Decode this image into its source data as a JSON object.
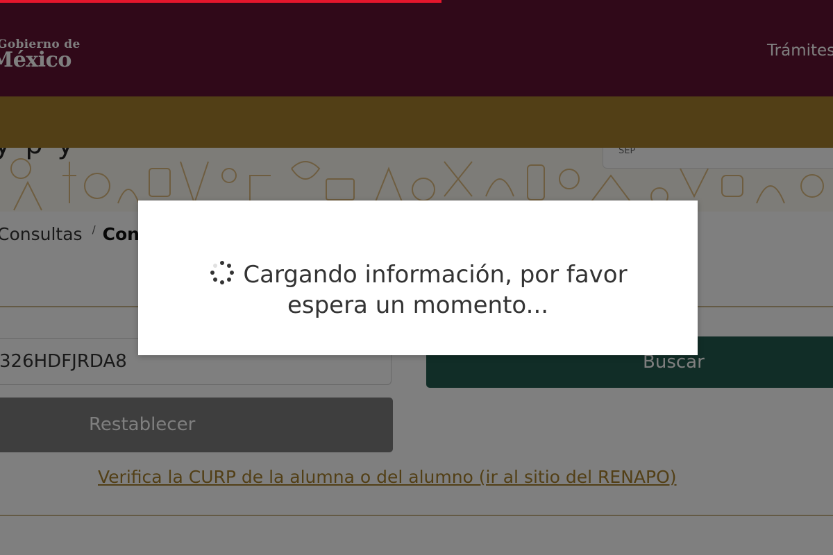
{
  "progress": {
    "fraction": 0.53,
    "color": "#e4162c"
  },
  "header": {
    "logo_line1": "Gobierno de",
    "logo_line2": "México",
    "nav_link": "Trámites",
    "color": "#611232"
  },
  "gold_bar": {
    "color": "#a57f2c"
  },
  "hero": {
    "title_partial": "y p     y",
    "card_text": "SEP"
  },
  "breadcrumb": {
    "parent": "Consultas",
    "current": "Consulta"
  },
  "form": {
    "curp_value": "326HDFJRDA8",
    "search_label": "Buscar",
    "reset_label": "Restablecer",
    "renapo_link": "Verifica la CURP de la alumna o del alumno (ir al sitio del RENAPO)"
  },
  "modal": {
    "line1": "Cargando información, por favor",
    "line2": "espera un momento..."
  },
  "icons": {
    "spinner": "spinner-icon"
  },
  "colors": {
    "accent_green": "#235b4e",
    "accent_gold": "#a57f2c"
  }
}
